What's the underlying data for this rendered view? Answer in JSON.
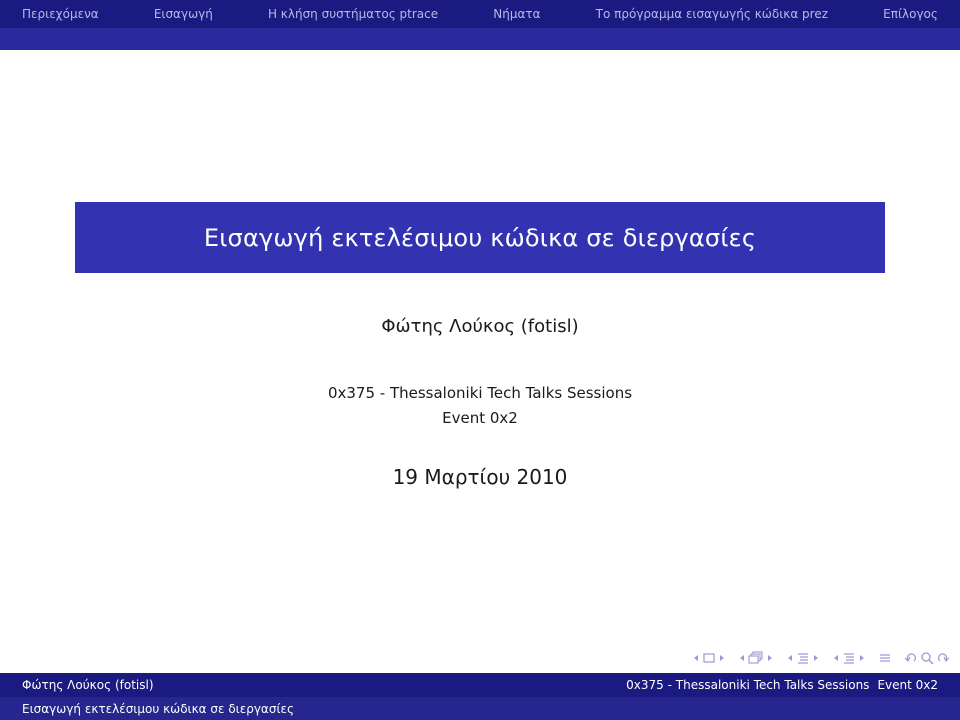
{
  "nav": {
    "items": [
      "Περιεχόμενα",
      "Εισαγωγή",
      "Η κλήση συστήματος ptrace",
      "Νήματα",
      "Το πρόγραμμα εισαγωγής κώδικα prez",
      "Επίλογος"
    ]
  },
  "slide": {
    "title": "Εισαγωγή εκτελέσιμου κώδικα σε διεργασίες",
    "author": "Φώτης Λούκος (fotisl)",
    "institute_line1": "0x375 - Thessaloniki Tech Talks Sessions",
    "institute_line2": "Event 0x2",
    "date": "19 Μαρτίου 2010"
  },
  "footer": {
    "author": "Φώτης Λούκος (fotisl)",
    "institute": "0x375 - Thessaloniki Tech Talks Sessions",
    "event": "Event 0x2",
    "title": "Εισαγωγή εκτελέσιμου κώδικα σε διεργασίες"
  },
  "colors": {
    "nav_bg": "#1a1a80",
    "title_bg": "#3333b2",
    "nav_text": "#b8b8e8"
  },
  "icons": [
    "arrow-left-icon",
    "frame-icon",
    "arrow-right-icon",
    "arrow-left-icon",
    "subsection-icon",
    "arrow-right-icon",
    "arrow-left-icon",
    "section-icon",
    "arrow-right-icon",
    "arrow-left-icon",
    "subsection-icon",
    "arrow-right-icon",
    "align-icon",
    "undo-icon",
    "search-icon",
    "redo-icon"
  ]
}
